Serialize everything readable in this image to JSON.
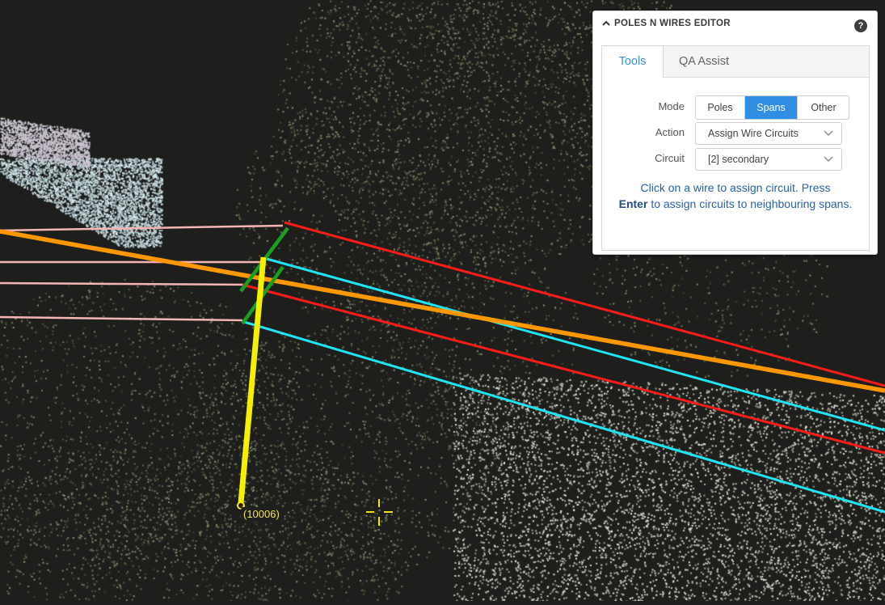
{
  "scene": {
    "pole_label": "(10006)",
    "colors": {
      "background": "#1e1e1c",
      "primary_wire": "#ff9800",
      "secondary_wire": "#ff1a1a",
      "cyan_wire": "#22e3f2",
      "unassigned_wire": "#f5b5b5",
      "pole": "#f5f000",
      "crossarm": "#1aa020",
      "cursor": "#f5e600"
    }
  },
  "panel": {
    "title": "POLES N WIRES EDITOR",
    "help_glyph": "?",
    "tabs": [
      {
        "label": "Tools",
        "active": true
      },
      {
        "label": "QA Assist",
        "active": false
      }
    ],
    "mode": {
      "label": "Mode",
      "options": [
        "Poles",
        "Spans",
        "Other"
      ],
      "selected": "Spans"
    },
    "action": {
      "label": "Action",
      "value": "Assign Wire Circuits"
    },
    "circuit": {
      "label": "Circuit",
      "value": "[2] secondary"
    },
    "hint": {
      "before": "Click on a wire to assign circuit. Press",
      "key": "Enter",
      "after": "to assign circuits to neighbouring spans."
    },
    "accent": "#2f8ee4"
  }
}
